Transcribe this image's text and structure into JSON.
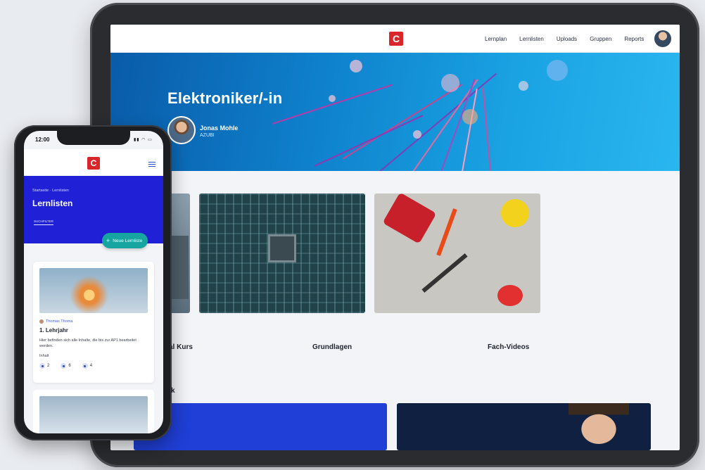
{
  "tablet": {
    "logo": "C",
    "nav": [
      "Lernplan",
      "Lernlisten",
      "Uploads",
      "Gruppen",
      "Reports"
    ],
    "hero": {
      "title": "Elektroniker/-in",
      "author_name": "Jonas Mohle",
      "author_role": "AZUBI"
    },
    "cards": [
      {
        "label": "al Kurs"
      },
      {
        "label": "Grundlagen"
      },
      {
        "label": "Fach-Videos"
      }
    ],
    "section2_label": "k"
  },
  "phone": {
    "status_time": "12:00",
    "status_icons": "▮▮ ◠ ▭",
    "logo": "C",
    "breadcrumb": "Startseite · Lernlisten",
    "title": "Lernlisten",
    "tab_label": "SUCHFILTER",
    "new_button": "Neue Lernliste",
    "card": {
      "author": "Thomas Thoma",
      "title": "1. Lehrjahr",
      "description": "Hier befinden sich alle Inhalte, die bis zur AP1 bearbeitet werden.",
      "inhalt_label": "Inhalt",
      "stats": [
        "2",
        "6",
        "4"
      ]
    }
  },
  "colors": {
    "brand_red": "#d8262b",
    "phone_banner": "#2020d6",
    "accent_teal": "#16a5a0",
    "hero_blue": "#0e7fcb"
  }
}
